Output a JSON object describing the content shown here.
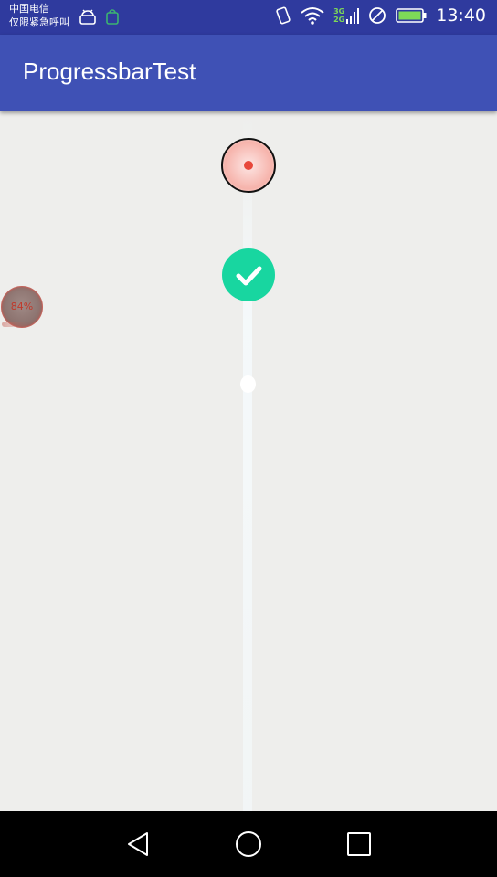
{
  "status_bar": {
    "carrier_line1": "中国电信",
    "carrier_line2": "仅限紧急呼叫",
    "network_top": "3G",
    "network_bottom": "2G",
    "time": "13:40",
    "icons": [
      "android-debug-icon",
      "notification-app-icon",
      "vibrate-icon",
      "wifi-icon",
      "signal-icon",
      "no-sim-icon",
      "battery-icon"
    ]
  },
  "app_bar": {
    "title": "ProgressbarTest"
  },
  "content": {
    "ball_progress_label": "84%",
    "record_progress_color": "#e8473a",
    "success_color": "#18d6a0"
  },
  "nav_bar": {
    "buttons": [
      "back-icon",
      "home-icon",
      "recents-icon"
    ]
  },
  "colors": {
    "status_bar": "#2f3a9e",
    "app_bar": "#3f51b5",
    "background": "#eeeeec"
  }
}
